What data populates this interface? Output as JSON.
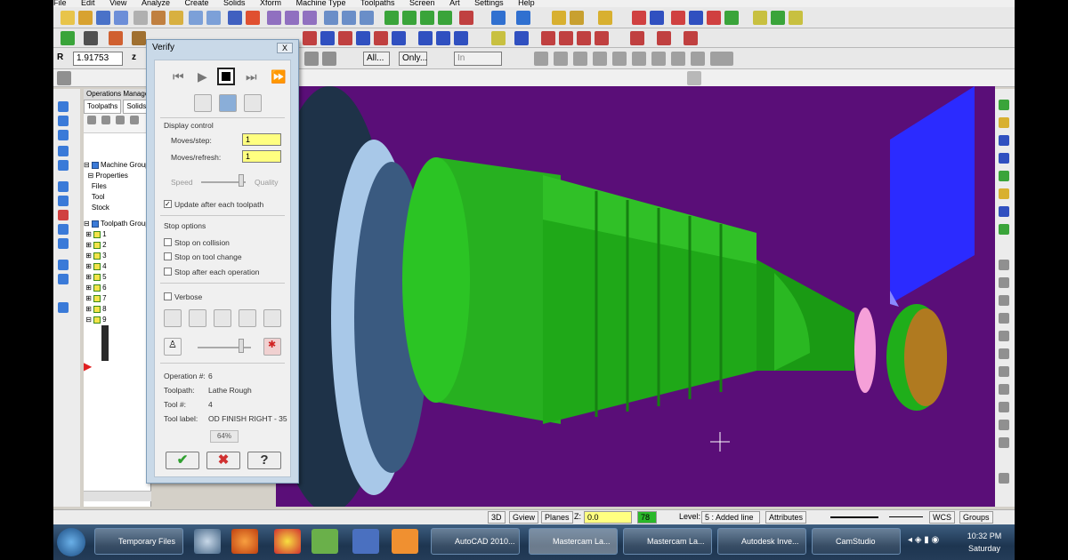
{
  "menu": [
    "File",
    "Edit",
    "View",
    "Analyze",
    "Create",
    "Solids",
    "Xform",
    "Machine Type",
    "Toolpaths",
    "Screen",
    "Art",
    "Settings",
    "Help"
  ],
  "toolbar": {
    "z_depth": "1.91753",
    "all_label": "All...",
    "only_label": "Only...",
    "in_label": "In"
  },
  "ops_manager": {
    "title": "Operations Manager",
    "tabs": [
      "Toolpaths",
      "Solids"
    ],
    "tree": [
      "Machine Group",
      "Properties",
      "Files",
      "Tool",
      "Stock",
      "Toolpath Group",
      "1",
      "2",
      "3",
      "4",
      "5",
      "6",
      "7",
      "8",
      "9"
    ]
  },
  "verify": {
    "title": "Verify",
    "close": "X",
    "display_control": "Display control",
    "moves_step_label": "Moves/step:",
    "moves_step_value": "1",
    "moves_refresh_label": "Moves/refresh:",
    "moves_refresh_value": "1",
    "speed_label": "Speed",
    "quality_label": "Quality",
    "update_after": "Update after each toolpath",
    "stop_options": "Stop options",
    "stop_collision": "Stop on collision",
    "stop_tool_change": "Stop on tool change",
    "stop_after_op": "Stop after each operation",
    "verbose": "Verbose",
    "operation_label": "Operation #:",
    "operation_value": "6",
    "toolpath_label": "Toolpath:",
    "toolpath_value": "Lathe Rough",
    "toolnum_label": "Tool #:",
    "toolnum_value": "4",
    "toollabel_label": "Tool label:",
    "toollabel_value": "OD FINISH RIGHT - 35",
    "progress": "64%",
    "ok_icon": "✔",
    "cancel_icon": "✖",
    "help_icon": "?"
  },
  "status": {
    "view3d": "3D",
    "gview": "Gview",
    "planes": "Planes",
    "z_label": "Z:",
    "z_value": "0.0",
    "color_value": "78",
    "level_label": "Level:",
    "level_value": "5 : Added line",
    "attributes": "Attributes",
    "wcs": "WCS",
    "groups": "Groups"
  },
  "taskbar": {
    "tasks": [
      "Temporary Files",
      "AutoCAD 2010...",
      "Mastercam La...",
      "Mastercam La...",
      "Autodesk Inve...",
      "CamStudio"
    ],
    "time": "10:32 PM",
    "day": "Saturday"
  },
  "colors": {
    "viewport_bg": "#5a0e78",
    "part_green": "#1fae1a",
    "tool_blue": "#2b2bff",
    "highlight_pink": "#f5a0d8"
  }
}
